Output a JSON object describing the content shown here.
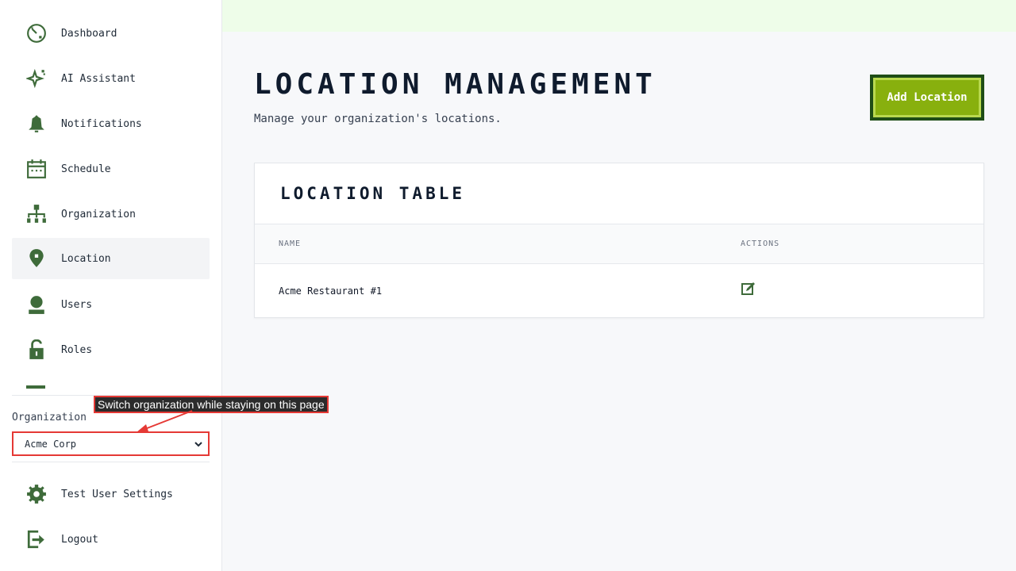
{
  "sidebar": {
    "items": [
      {
        "label": "Dashboard",
        "icon": "dashboard-icon"
      },
      {
        "label": "AI Assistant",
        "icon": "sparkle-icon"
      },
      {
        "label": "Notifications",
        "icon": "bell-icon"
      },
      {
        "label": "Schedule",
        "icon": "calendar-icon"
      },
      {
        "label": "Organization",
        "icon": "org-chart-icon"
      },
      {
        "label": "Location",
        "icon": "location-pin-icon",
        "active": true
      },
      {
        "label": "Users",
        "icon": "user-icon"
      },
      {
        "label": "Roles",
        "icon": "lock-icon"
      }
    ],
    "org_label": "Organization",
    "org_selected": "Acme Corp",
    "footer": [
      {
        "label": "Test User Settings",
        "icon": "gear-icon"
      },
      {
        "label": "Logout",
        "icon": "logout-icon"
      }
    ]
  },
  "annotation": {
    "tooltip": "Switch organization while staying on this page"
  },
  "main": {
    "title": "Location Management",
    "subtitle": "Manage your organization's locations.",
    "add_button": "Add Location",
    "table": {
      "title": "Location Table",
      "columns": [
        "Name",
        "Actions"
      ],
      "rows": [
        {
          "name": "Acme Restaurant #1"
        }
      ]
    }
  },
  "colors": {
    "accent": "#88b00e",
    "accent_dark": "#1f4d16",
    "icon_green": "#3e6b3a",
    "annotation_red": "#e53935",
    "top_band": "#eefde9"
  }
}
